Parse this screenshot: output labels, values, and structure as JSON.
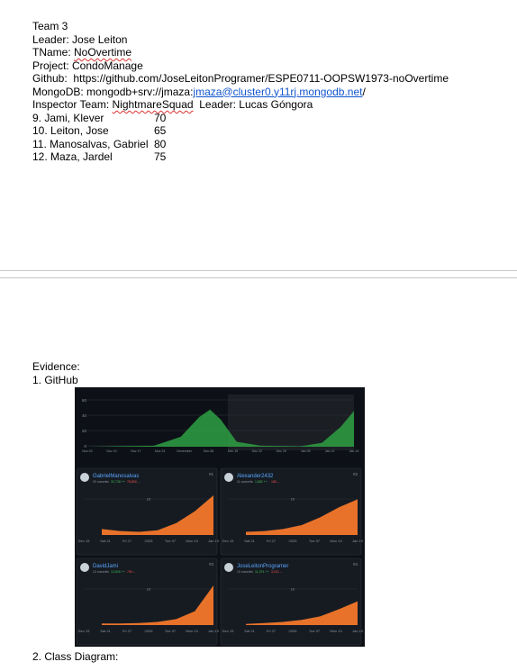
{
  "doc": {
    "team": "Team 3",
    "leader": "Leader: Jose Leiton",
    "tname_prefix": "TName: ",
    "tname_value": "NoOvertime",
    "project": "Project: CondoManage",
    "github": "Github:  https://github.com/JoseLeitonProgramer/ESPE0711-OOPSW1973-noOvertime",
    "mongodb_prefix": "MongoDB: mongodb+srv://jmaza:",
    "mongodb_link": "jmaza@cluster0.y11rj.mongodb.net",
    "mongodb_suffix": "/",
    "inspector_prefix": "Inspector Team: ",
    "inspector_team": "NightmareSquad",
    "inspector_leader": "  Leader: Lucas Góngora",
    "members": [
      {
        "name": "9. Jami, Klever",
        "score": "70"
      },
      {
        "name": "10. Leiton, Jose",
        "score": "65"
      },
      {
        "name": "11. Manosalvas, Gabriel",
        "score": "80"
      },
      {
        "name": "12. Maza, Jardel",
        "score": "75"
      }
    ],
    "evidence": "Evidence:",
    "github_heading": "1. GitHub",
    "class_diagram_heading": "2. Class Diagram:"
  },
  "colors": {
    "link": "#1155cc",
    "screenshot_bg": "#0d1117",
    "panel_bg": "#161b22",
    "green_area": "#2ea043",
    "orange_area": "#e8722a",
    "user_name": "#58a6ff"
  },
  "screenshot": {
    "overview_ticks": [
      "Nov 03",
      "Nov 10",
      "Nov 17",
      "Nov 24",
      "December",
      "Dec 08",
      "Dec 15",
      "Dec 22",
      "Dec 29",
      "Jan 05",
      "Jan 12",
      "Jan 19"
    ],
    "overview_y": [
      "60",
      "40",
      "20",
      "0"
    ],
    "contributors": [
      {
        "user": "GabrielManosalvas",
        "rank": "#1",
        "commits": "20 commits",
        "added": "32,738 ++",
        "removed": "78,800 --",
        "y_label": "10",
        "ticks": [
          "Dec 15",
          "Sat 21",
          "Fri 27",
          "2025",
          "Tue 07",
          "Mon 13",
          "Jan 19"
        ],
        "curve": [
          0.15,
          0.1,
          0.08,
          0.12,
          0.3,
          0.6,
          1.0
        ]
      },
      {
        "user": "Alexander2432",
        "rank": "#2",
        "commits": "11 commits",
        "added": "1,882 ++",
        "removed": "180 --",
        "y_label": "10",
        "ticks": [
          "Dec 15",
          "Sat 21",
          "Fri 27",
          "2025",
          "Tue 07",
          "Mon 13",
          "Jan 19"
        ],
        "curve": [
          0.08,
          0.1,
          0.15,
          0.25,
          0.45,
          0.7,
          0.9
        ]
      },
      {
        "user": "DavidJami",
        "rank": "#3",
        "commits": "13 commits",
        "added": "13,805 ++",
        "removed": "790 --",
        "y_label": "10",
        "ticks": [
          "Dec 15",
          "Sat 21",
          "Fri 27",
          "2025",
          "Tue 07",
          "Mon 13",
          "Jan 19"
        ],
        "curve": [
          0.04,
          0.04,
          0.05,
          0.08,
          0.15,
          0.35,
          1.0
        ]
      },
      {
        "user": "JoseLeitonProgramer",
        "rank": "#4",
        "commits": "10 commits",
        "added": "11,974 ++",
        "removed": "3,110 --",
        "y_label": "10",
        "ticks": [
          "Dec 15",
          "Sat 21",
          "Fri 27",
          "2025",
          "Tue 07",
          "Mon 13",
          "Jan 19"
        ],
        "curve": [
          0.03,
          0.05,
          0.08,
          0.13,
          0.22,
          0.4,
          0.6
        ]
      }
    ]
  }
}
